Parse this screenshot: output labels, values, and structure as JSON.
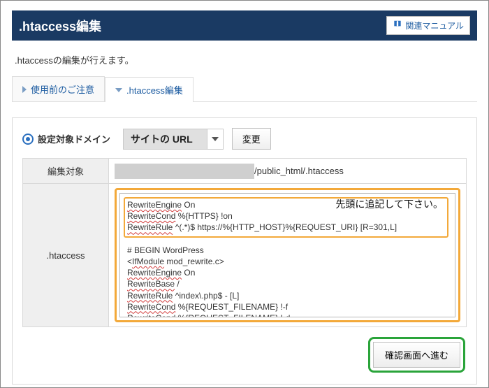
{
  "titlebar": {
    "title": ".htaccess編集",
    "manual_label": "関連マニュアル"
  },
  "description": ".htaccessの編集が行えます。",
  "tabs": {
    "precautions": "使用前のご注意",
    "edit": ".htaccess編集"
  },
  "domain": {
    "label": "設定対象ドメイン",
    "selected": "サイトの URL",
    "change": "変更"
  },
  "rows": {
    "target_label": "編集対象",
    "target_path": "/public_html/.htaccess",
    "htaccess_label": ".htaccess"
  },
  "editor_text": "RewriteEngine On\nRewriteCond %{HTTPS} !on\nRewriteRule ^(.*)$ https://%{HTTP_HOST}%{REQUEST_URI} [R=301,L]\n\n# BEGIN WordPress\n<IfModule mod_rewrite.c>\nRewriteEngine On\nRewriteBase /\nRewriteRule ^index\\.php$ - [L]\nRewriteCond %{REQUEST_FILENAME} !-f\nRewriteCond %{REQUEST_FILENAME} !-d\nRewriteRule . /index.php [L]\n</IfModule>\n# END WordPress",
  "annotation": "先頭に追記して下さい。",
  "confirm": "確認画面へ進む"
}
